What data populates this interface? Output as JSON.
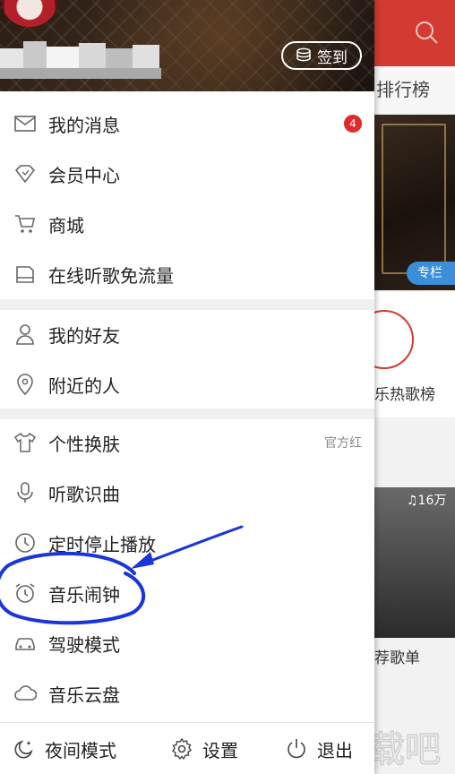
{
  "background_app": {
    "tab_label": "排行榜",
    "column_badge": "专栏",
    "rank_card_label": "乐热歌榜",
    "play_count": "♫16万",
    "recommend_label": "荐歌单",
    "watermark": "下载吧"
  },
  "profile": {
    "checkin_label": "签到"
  },
  "menu": {
    "group1": [
      {
        "label": "我的消息",
        "icon": "mail-icon",
        "badge": "4"
      },
      {
        "label": "会员中心",
        "icon": "diamond-icon"
      },
      {
        "label": "商城",
        "icon": "cart-icon"
      },
      {
        "label": "在线听歌免流量",
        "icon": "sim-card-icon"
      }
    ],
    "group2": [
      {
        "label": "我的好友",
        "icon": "person-icon"
      },
      {
        "label": "附近的人",
        "icon": "location-pin-icon"
      }
    ],
    "group3": [
      {
        "label": "个性换肤",
        "icon": "tshirt-icon",
        "extra": "官方红"
      },
      {
        "label": "听歌识曲",
        "icon": "microphone-icon"
      },
      {
        "label": "定时停止播放",
        "icon": "clock-icon"
      },
      {
        "label": "音乐闹钟",
        "icon": "alarm-clock-icon"
      },
      {
        "label": "驾驶模式",
        "icon": "car-icon"
      },
      {
        "label": "音乐云盘",
        "icon": "cloud-icon"
      }
    ]
  },
  "footer": {
    "night_mode": "夜间模式",
    "settings": "设置",
    "logout": "退出"
  },
  "colors": {
    "accent_red": "#d33a31",
    "annotation_blue": "#1a35d8"
  }
}
